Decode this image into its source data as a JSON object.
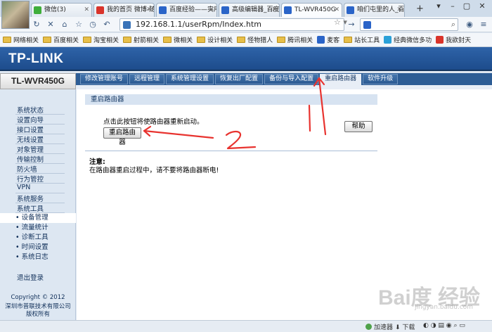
{
  "browser": {
    "tabs": [
      {
        "label": "微信(3)",
        "color": "#3fae3a"
      },
      {
        "label": "我的首页 微博-随",
        "color": "#d9342b"
      },
      {
        "label": "百度经验——实用",
        "color": "#2a64c8"
      },
      {
        "label": "高级编辑器_百度",
        "color": "#2a64c8"
      },
      {
        "label": "TL-WVR450G",
        "color": "#2a64c8"
      },
      {
        "label": "咱们屯里的人_百",
        "color": "#2a64c8"
      }
    ],
    "new_tab": "+",
    "url": "192.168.1.1/userRpm/Index.htm",
    "bookmarks": [
      {
        "label": "网络相关",
        "kind": "folder"
      },
      {
        "label": "百度相关",
        "kind": "folder"
      },
      {
        "label": "淘宝相关",
        "kind": "folder"
      },
      {
        "label": "射箭相关",
        "kind": "folder"
      },
      {
        "label": "微相关",
        "kind": "folder"
      },
      {
        "label": "设计相关",
        "kind": "folder"
      },
      {
        "label": "怪物猎人",
        "kind": "folder"
      },
      {
        "label": "腾讯相关",
        "kind": "folder"
      },
      {
        "label": "麦客",
        "kind": "site",
        "color": "#2a64c8"
      },
      {
        "label": "站长工具",
        "kind": "folder"
      },
      {
        "label": "经典微信多功",
        "kind": "site",
        "color": "#2aa0d8"
      },
      {
        "label": "我欲封天",
        "kind": "site",
        "color": "#d9342b"
      }
    ],
    "status_bar": {
      "accelerator": "加速器",
      "download": "下载"
    }
  },
  "router": {
    "logo": "TP-LINK",
    "model": "TL-WVR450G",
    "top_nav": [
      {
        "label": "修改管理账号",
        "active": false
      },
      {
        "label": "远程管理",
        "active": false
      },
      {
        "label": "系统管理设置",
        "active": false
      },
      {
        "label": "恢复出厂配置",
        "active": false
      },
      {
        "label": "备份与导入配置",
        "active": false
      },
      {
        "label": "重启路由器",
        "active": true
      },
      {
        "label": "软件升级",
        "active": false
      }
    ],
    "sidebar": {
      "items": [
        "系统状态",
        "设置向导",
        "接口设置",
        "无线设置",
        "对象管理",
        "传输控制",
        "防火墙",
        "行为管控",
        "VPN",
        "系统服务",
        "系统工具"
      ],
      "subitems": [
        {
          "label": "• 设备管理",
          "active": true
        },
        {
          "label": "• 流量统计",
          "active": false
        },
        {
          "label": "• 诊断工具",
          "active": false
        },
        {
          "label": "• 时间设置",
          "active": false
        },
        {
          "label": "• 系统日志",
          "active": false
        }
      ],
      "logout": "退出登录",
      "copyright": "Copyright © 2012",
      "company": "深圳市普联技术有限公司",
      "rights": "版权所有"
    },
    "panel": {
      "title": "重启路由器",
      "description": "点击此按钮将使路由器重新启动。",
      "reboot_button": "重启路由器",
      "help_button": "帮助",
      "note_title": "注意:",
      "note_text": "在路由器重启过程中，请不要将路由器断电!"
    }
  },
  "annotations": {
    "mark_1": "1",
    "mark_2": "2",
    "color": "#e8332f"
  },
  "watermark": {
    "brand": "Bai度 经验",
    "sub": "jingyan.baidu.com"
  }
}
